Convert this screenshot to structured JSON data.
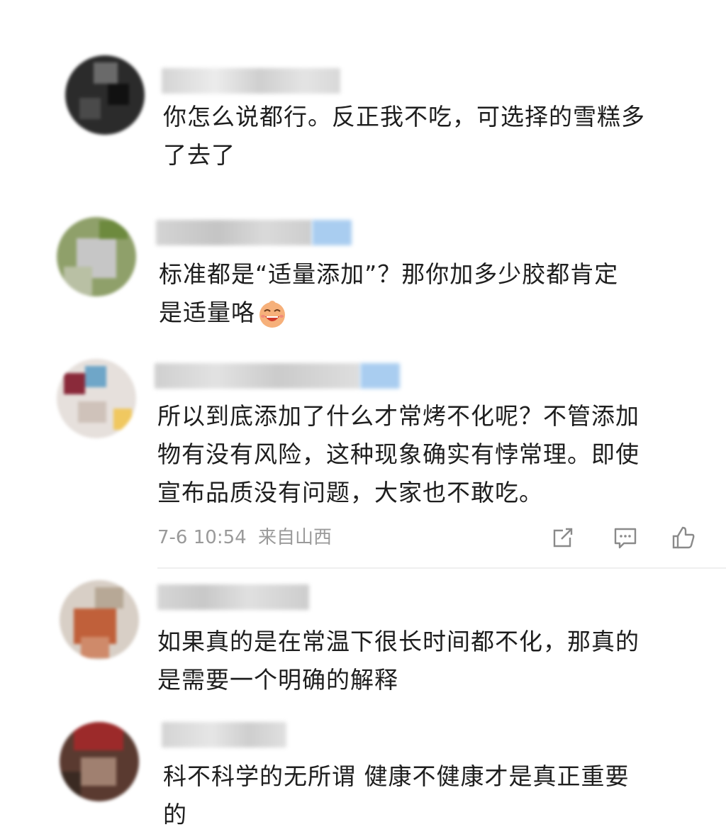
{
  "comments": [
    {
      "text_line1": "你怎么说都行。反正我不吃，可选择的雪糕多",
      "text_line2": "了去了",
      "name_blurred": true,
      "avatar_blurred": true
    },
    {
      "text_line1": "标准都是“适量添加”？那你加多少胶都肯定",
      "text_line2": "是适量咯",
      "emoji": "laughing-face-emoji",
      "name_blurred": true,
      "avatar_blurred": true
    },
    {
      "text_line1": "所以到底添加了什么才常烤不化呢？不管添加",
      "text_line2": "物有没有风险，这种现象确实有悖常理。即使",
      "text_line3": "宣布品质没有问题，大家也不敢吃。",
      "time": "7-6 10:54",
      "location": "来自山西",
      "actions": [
        "share-icon",
        "comment-icon",
        "like-icon"
      ],
      "name_blurred": true,
      "avatar_blurred": true
    },
    {
      "text_line1": "如果真的是在常温下很长时间都不化，那真的",
      "text_line2": "是需要一个明确的解释",
      "name_blurred": true,
      "avatar_blurred": true
    },
    {
      "text_line1": "科不科学的无所谓 健康不健康才是真正重要",
      "text_line2": "的",
      "name_blurred": true,
      "avatar_blurred": true
    }
  ],
  "colors": {
    "text": "#1e1e1e",
    "meta": "#9a9a9a",
    "background": "#ffffff",
    "vip_blue": "#a9cdf0"
  }
}
